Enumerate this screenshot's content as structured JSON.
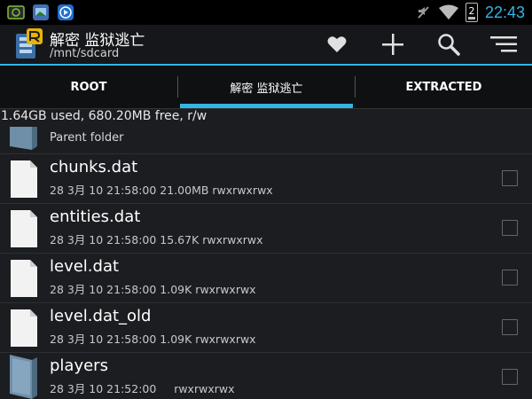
{
  "status_bar": {
    "time": "22:43",
    "battery_level": "2",
    "left_icons": [
      "android-system-icon",
      "gallery-icon",
      "media-player-icon"
    ],
    "right_icons": [
      "mute-icon",
      "wifi-icon",
      "battery-icon"
    ]
  },
  "action_bar": {
    "title": "解密 监狱逃亡",
    "path": "/mnt/sdcard",
    "actions": [
      "heart-icon",
      "plus-icon",
      "search-icon",
      "menu-icon"
    ],
    "accent": "#33b5e5"
  },
  "tabs": [
    {
      "label": "ROOT",
      "active": false
    },
    {
      "label": "解密 监狱逃亡",
      "active": true
    },
    {
      "label": "EXTRACTED",
      "active": false
    }
  ],
  "storage_info": "1.64GB used, 680.20MB free, r/w",
  "files": {
    "parent": {
      "label": "Parent folder"
    },
    "items": [
      {
        "name": "chunks.dat",
        "meta": "28 3月 10 21:58:00  21.00MB  rwxrwxrwx",
        "type": "file"
      },
      {
        "name": "entities.dat",
        "meta": "28 3月 10 21:58:00  15.67K  rwxrwxrwx",
        "type": "file"
      },
      {
        "name": "level.dat",
        "meta": "28 3月 10 21:58:00  1.09K  rwxrwxrwx",
        "type": "file"
      },
      {
        "name": "level.dat_old",
        "meta": "28 3月 10 21:58:00  1.09K  rwxrwxrwx",
        "type": "file"
      },
      {
        "name": "players",
        "meta": "28 3月 10 21:52:00     rwxrwxrwx",
        "type": "folder"
      }
    ]
  }
}
